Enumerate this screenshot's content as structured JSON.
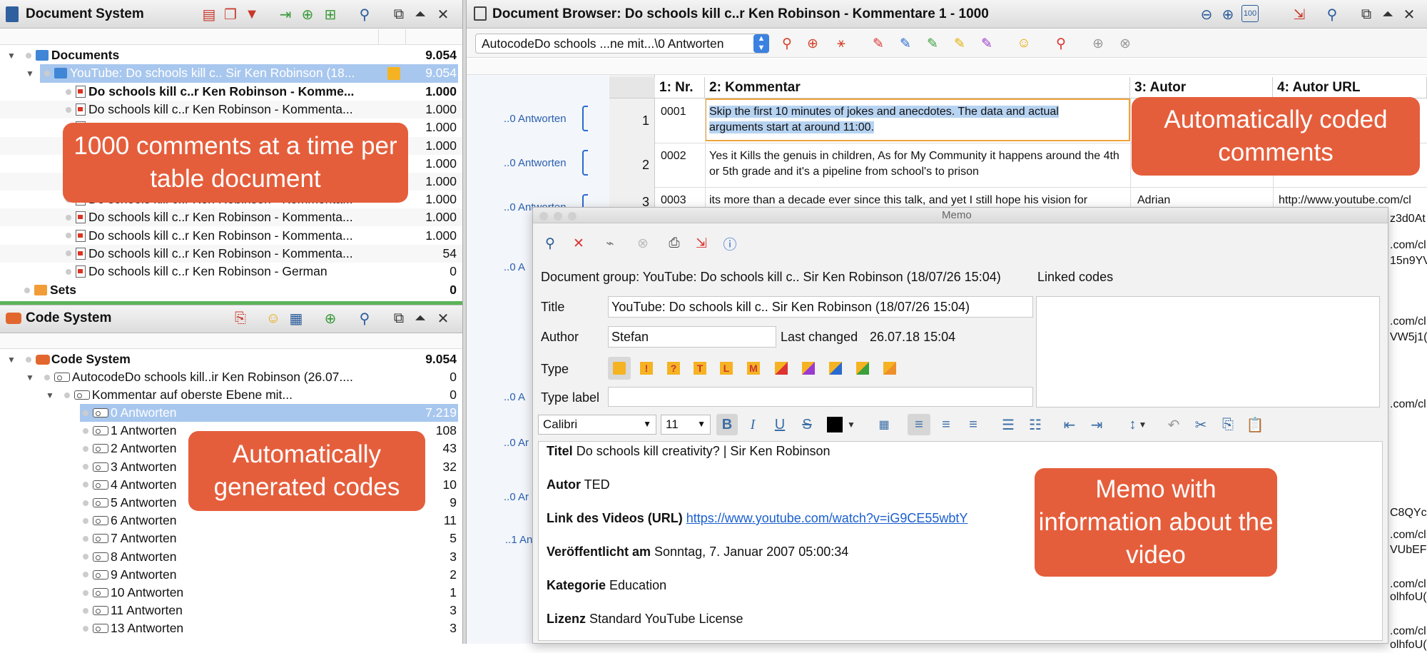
{
  "doc_system": {
    "title": "Document System",
    "root": {
      "label": "Documents",
      "count": "9.054"
    },
    "group": {
      "label": "YouTube: Do schools kill c.. Sir Ken Robinson (18...",
      "count": "9.054"
    },
    "docs": [
      {
        "label": "Do schools kill c..r Ken Robinson -  Komme...",
        "count": "1.000",
        "bold": true
      },
      {
        "label": "Do schools kill c..r Ken Robinson -  Kommenta...",
        "count": "1.000"
      },
      {
        "label": "",
        "count": "1.000"
      },
      {
        "label": "",
        "count": "1.000"
      },
      {
        "label": "",
        "count": "1.000"
      },
      {
        "label": "",
        "count": "1.000"
      },
      {
        "label": "Do schools kill c..r Ken Robinson -  Kommenta...",
        "count": "1.000"
      },
      {
        "label": "Do schools kill c..r Ken Robinson -  Kommenta...",
        "count": "1.000"
      },
      {
        "label": "Do schools kill c..r Ken Robinson -  Kommenta...",
        "count": "1.000"
      },
      {
        "label": "Do schools kill c..r Ken Robinson -  Kommenta...",
        "count": "54"
      },
      {
        "label": "Do schools kill c..r Ken Robinson - German",
        "count": "0"
      }
    ],
    "sets": {
      "label": "Sets",
      "count": "0"
    }
  },
  "code_system": {
    "title": "Code System",
    "root": {
      "label": "Code System",
      "count": "9.054"
    },
    "autocode": {
      "label": "AutocodeDo schools kill..ir Ken Robinson (26.07....",
      "count": "0"
    },
    "komm": {
      "label": "Kommentar auf oberste Ebene mit...",
      "count": "0"
    },
    "codes": [
      {
        "label": "0 Antworten",
        "count": "7.219"
      },
      {
        "label": "1 Antworten",
        "count": "108"
      },
      {
        "label": "2 Antworten",
        "count": "43"
      },
      {
        "label": "3 Antworten",
        "count": "32"
      },
      {
        "label": "4 Antworten",
        "count": "10"
      },
      {
        "label": "5 Antworten",
        "count": "9"
      },
      {
        "label": "6 Antworten",
        "count": "11"
      },
      {
        "label": "7 Antworten",
        "count": "5"
      },
      {
        "label": "8 Antworten",
        "count": "3"
      },
      {
        "label": "9 Antworten",
        "count": "2"
      },
      {
        "label": "10 Antworten",
        "count": "1"
      },
      {
        "label": "11 Antworten",
        "count": "3"
      },
      {
        "label": "13 Antworten",
        "count": "3"
      }
    ]
  },
  "browser": {
    "title": "Document Browser: Do schools kill c..r Ken Robinson -  Kommentare 1 - 1000",
    "code_select": "AutocodeDo schools ...ne mit...\\0 Antworten",
    "columns": [
      "1: Nr.",
      "2: Kommentar",
      "3: Autor",
      "4: Autor URL"
    ],
    "rows": [
      {
        "idx": "1",
        "nr": "0001",
        "text": "Skip the first 10 minutes of jokes and anecdotes. The data and actual arguments start at around 11:00.",
        "autor": "",
        "url": ""
      },
      {
        "idx": "2",
        "nr": "0002",
        "text": "Yes it Kills the genuis in children, As for  My Community it happens around the 4th or 5th grade and it's a pipeline from school's to prison",
        "autor": "",
        "url": ""
      },
      {
        "idx": "3",
        "nr": "0003",
        "text": "its more than a decade ever since this talk, and yet I still hope his vision for",
        "autor": "Adrian",
        "url": "http://www.youtube.com/cl"
      }
    ],
    "side_labels": [
      "..0 Antworten",
      "..0 Antworten",
      "..0 Antworten",
      "..0 A",
      "..0 A",
      "..0 Ar",
      "..0 Ar",
      "..1 An"
    ],
    "url_fragments": [
      "z3d0At",
      ".com/cl",
      "15n9YV",
      ".com/cl",
      "VW5j1(",
      ".com/cl",
      "C8QYcG",
      ".com/cl",
      "VUbEF(",
      ".com/cl",
      "olhfoU(",
      ".com/cl",
      "olhfoU(",
      "8QYcG"
    ]
  },
  "memo": {
    "window_title": "Memo",
    "group_line": "Document group: YouTube: Do schools kill c.. Sir Ken Robinson (18/07/26 15:04)",
    "linked_codes_label": "Linked codes",
    "title_label": "Title",
    "title_value": "YouTube: Do schools kill c.. Sir Ken Robinson (18/07/26 15:04)",
    "author_label": "Author",
    "author_value": "Stefan",
    "changed_label": "Last changed",
    "changed_value": "26.07.18 15:04",
    "type_label": "Type",
    "type_label_label": "Type label",
    "font": "Calibri",
    "size": "11",
    "content": [
      {
        "key": "Titel",
        "value": " Do schools kill creativity? | Sir Ken Robinson"
      },
      {
        "key": "Autor",
        "value": " TED"
      },
      {
        "key": "Link des Videos (URL)",
        "value": "https://www.youtube.com/watch?v=iG9CE55wbtY",
        "link": true
      },
      {
        "key": "Veröffentlicht am",
        "value": " Sonntag, 7. Januar 2007 05:00:34"
      },
      {
        "key": "Kategorie",
        "value": " Education"
      },
      {
        "key": "Lizenz",
        "value": " Standard YouTube License"
      }
    ]
  },
  "callouts": {
    "c1": "1000 comments at a time per table document",
    "c2": "Automatically generated codes",
    "c3": "Automatically coded comments",
    "c4": "Memo with information about the video"
  },
  "colors": {
    "accent": "#e55e3c",
    "selection": "#a8c7ee",
    "green_divider": "#5bb45a"
  }
}
